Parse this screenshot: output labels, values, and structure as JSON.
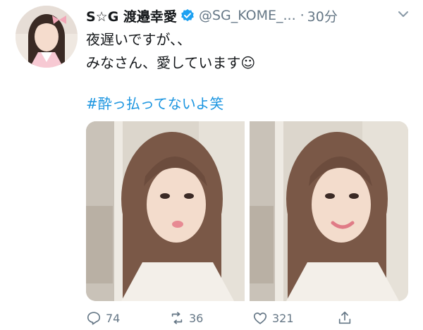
{
  "tweet": {
    "display_name": "S☆G 渡邉幸愛",
    "handle": "@SG_KOME_...",
    "separator": "·",
    "time": "30分",
    "text_lines": [
      "夜遅いですが、、",
      "みなさん、愛しています☺"
    ],
    "hashtag": "#酔っ払ってないよ笑"
  },
  "actions": {
    "reply_count": "74",
    "retweet_count": "36",
    "like_count": "321"
  },
  "icons": {
    "verified": "verified-badge-icon",
    "chevron": "chevron-down-icon",
    "reply": "reply-icon",
    "retweet": "retweet-icon",
    "like": "heart-icon",
    "share": "share-icon"
  },
  "colors": {
    "text": "#14171a",
    "secondary": "#657786",
    "link": "#1b95e0",
    "verified": "#1da1f2"
  }
}
